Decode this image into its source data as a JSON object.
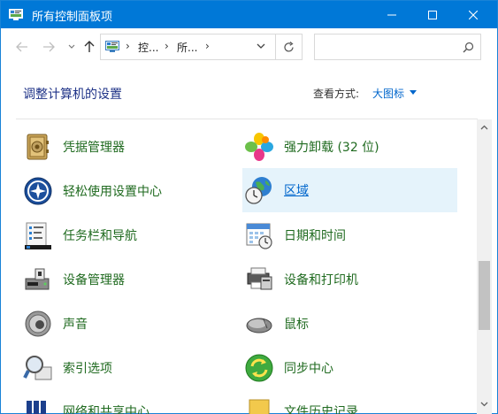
{
  "window": {
    "title": "所有控制面板项"
  },
  "address": {
    "crumbs": [
      "控...",
      "所..."
    ],
    "separator": "›"
  },
  "search": {
    "value": "",
    "placeholder": ""
  },
  "header": {
    "heading": "调整计算机的设置",
    "view_by_label": "查看方式:",
    "view_by_value": "大图标"
  },
  "items": [
    {
      "label": "凭据管理器",
      "icon": "credential-vault-icon"
    },
    {
      "label": "强力卸载 (32 位)",
      "icon": "uninstaller-flower-icon"
    },
    {
      "label": "轻松使用设置中心",
      "icon": "ease-of-access-icon"
    },
    {
      "label": "区域",
      "icon": "region-globe-clock-icon"
    },
    {
      "label": "任务栏和导航",
      "icon": "taskbar-icon"
    },
    {
      "label": "日期和时间",
      "icon": "date-time-icon"
    },
    {
      "label": "设备管理器",
      "icon": "device-manager-icon"
    },
    {
      "label": "设备和打印机",
      "icon": "devices-printers-icon"
    },
    {
      "label": "声音",
      "icon": "speaker-icon"
    },
    {
      "label": "鼠标",
      "icon": "mouse-icon"
    },
    {
      "label": "索引选项",
      "icon": "indexing-magnifier-icon"
    },
    {
      "label": "同步中心",
      "icon": "sync-center-icon"
    },
    {
      "label": "网络和共享中心",
      "icon": "network-sharing-icon"
    },
    {
      "label": "文件历史记录",
      "icon": "file-history-icon"
    }
  ],
  "colors": {
    "titlebar": "#0078d7",
    "item_label": "#1f6a1f",
    "hover_bg": "#e5f3fb",
    "heading": "#1e3287",
    "link": "#0066cc"
  }
}
